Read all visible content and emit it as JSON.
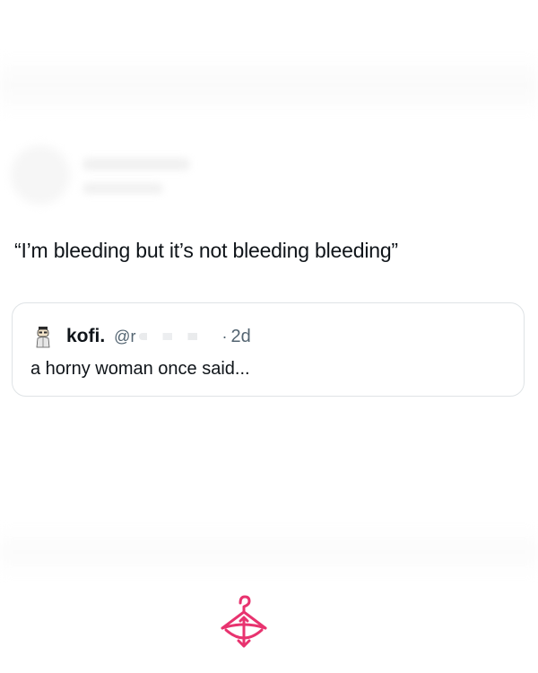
{
  "tweet": {
    "text": "“I’m bleeding but it’s not bleeding bleeding”"
  },
  "quoted_tweet": {
    "author_name": "kofi.",
    "handle_prefix": "@r",
    "separator": "·",
    "time": "2d",
    "text": "a horny woman once said..."
  },
  "colors": {
    "text_primary": "#0f1419",
    "text_secondary": "#536471",
    "border": "#dfe3e6",
    "watermark": "#e8336f"
  },
  "icons": {
    "avatar": "cartoon-avatar",
    "watermark": "hanger-arrow-logo"
  }
}
